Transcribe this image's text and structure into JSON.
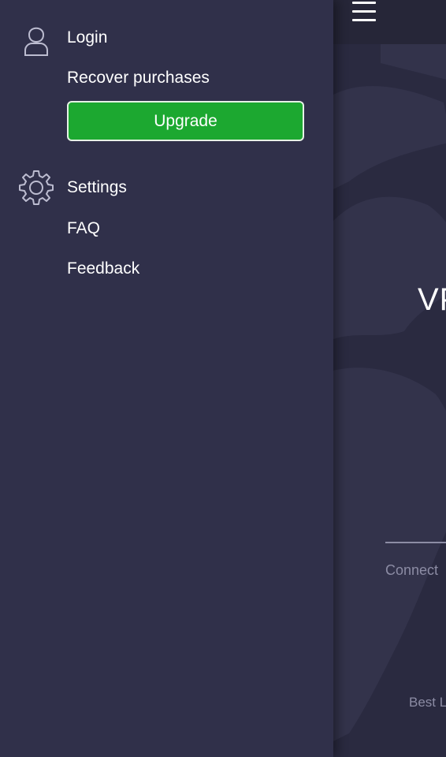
{
  "drawer": {
    "account": {
      "icon": "user-icon",
      "login_label": "Login",
      "recover_label": "Recover purchases",
      "upgrade_label": "Upgrade"
    },
    "settings": {
      "icon": "gear-icon",
      "settings_label": "Settings",
      "faq_label": "FAQ",
      "feedback_label": "Feedback"
    }
  },
  "main": {
    "menu_icon": "hamburger-menu-icon",
    "title_partial": "VP",
    "connect_label": "Connect",
    "best_label": "Best L"
  },
  "colors": {
    "drawer_bg": "#30304a",
    "main_bg": "#2a2a40",
    "upgrade_bg": "#1ca830",
    "text": "#ffffff",
    "muted_text": "#8c8ca4"
  }
}
